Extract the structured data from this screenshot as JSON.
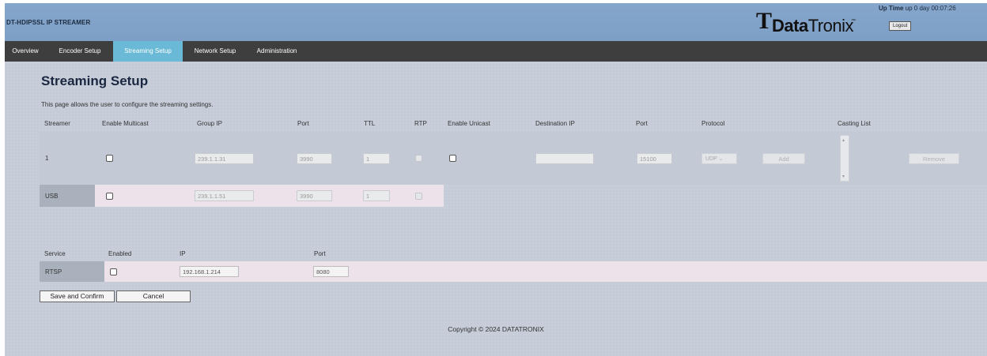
{
  "header": {
    "product": "DT-HDIPSSL IP STREAMER",
    "logo_mark": "T",
    "logo_bold": "Data",
    "logo_rest": "Tronix",
    "logo_tm": "™",
    "uptime_label": "Up Time",
    "uptime_value": " up 0 day 00:07:26",
    "logout": "Logout"
  },
  "nav": {
    "overview": "Overview",
    "encoder": "Encoder Setup",
    "streaming": "Streaming Setup",
    "network": "Network Setup",
    "admin": "Administration"
  },
  "page": {
    "title": "Streaming Setup",
    "description": "This page allows the user to configure the streaming settings."
  },
  "stream_table": {
    "headers": {
      "streamer": "Streamer",
      "enable_multicast": "Enable Multicast",
      "group_ip": "Group IP",
      "port": "Port",
      "ttl": "TTL",
      "rtp": "RTP",
      "enable_unicast": "Enable Unicast",
      "destination_ip": "Destination IP",
      "dest_port": "Port",
      "protocol": "Protocol",
      "casting_list": "Casting List"
    },
    "row1": {
      "streamer": "1",
      "group_ip": "239.1.1.31",
      "port": "3990",
      "ttl": "1",
      "destination_ip": "",
      "dest_port": "15100",
      "protocol": "UDP",
      "add": "Add",
      "remove": "Remove"
    },
    "row_usb": {
      "streamer": "USB",
      "group_ip": "239.1.1.51",
      "port": "3990",
      "ttl": "1"
    }
  },
  "service_table": {
    "headers": {
      "service": "Service",
      "enabled": "Enabled",
      "ip": "IP",
      "port": "Port"
    },
    "row": {
      "service": "RTSP",
      "ip": "192.168.1.214",
      "port": "8080"
    }
  },
  "actions": {
    "save": "Save and Confirm",
    "cancel": "Cancel"
  },
  "footer": {
    "copyright": "Copyright © 2024 DATATRONIX"
  },
  "colors": {
    "header_bg": "#86a6cb",
    "nav_bg": "#3e3e3e",
    "nav_active": "#6ab9d6",
    "row_highlight": "#ede2ea",
    "label_cell": "#a9b1bd"
  }
}
